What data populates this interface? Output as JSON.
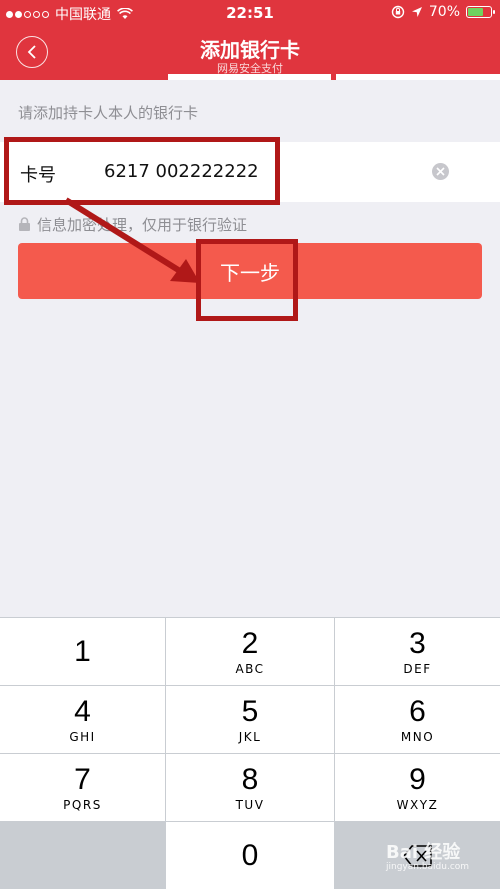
{
  "status_bar": {
    "carrier": "中国联通",
    "time": "22:51",
    "battery": "70%",
    "battery_level": 0.7
  },
  "header": {
    "title": "添加银行卡",
    "subtitle": "网易安全支付",
    "background_color": "#e0353e",
    "step_current": 1,
    "step_total": 3
  },
  "form": {
    "hint": "请添加持卡人本人的银行卡",
    "card_label": "卡号",
    "card_value": "6217 002222222",
    "secure_note": "信息加密处理，仅用于银行验证",
    "next_label": "下一步",
    "button_color": "#f45a4d"
  },
  "keypad": {
    "keys": [
      {
        "num": "1",
        "letters": ""
      },
      {
        "num": "2",
        "letters": "ABC"
      },
      {
        "num": "3",
        "letters": "DEF"
      },
      {
        "num": "4",
        "letters": "GHI"
      },
      {
        "num": "5",
        "letters": "JKL"
      },
      {
        "num": "6",
        "letters": "MNO"
      },
      {
        "num": "7",
        "letters": "PQRS"
      },
      {
        "num": "8",
        "letters": "TUV"
      },
      {
        "num": "9",
        "letters": "WXYZ"
      },
      {
        "num": "0",
        "letters": ""
      }
    ],
    "delete_icon": "backspace-icon"
  },
  "watermark": {
    "text": "Bai 经验",
    "url_text": "jingyan.baidu.com"
  }
}
